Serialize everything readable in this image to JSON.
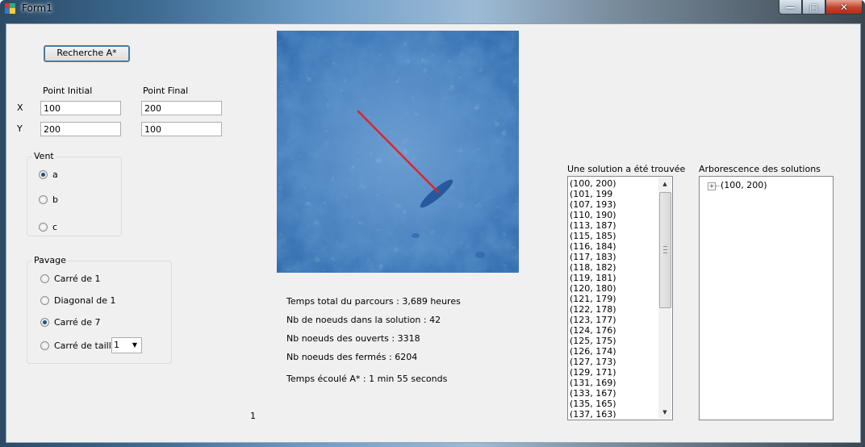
{
  "window": {
    "title": "Form1"
  },
  "title_buttons": {
    "minimize": "—",
    "maximize": "▢",
    "close": "✕"
  },
  "search_button": "Recherche A*",
  "coords": {
    "initial_label": "Point Initial",
    "final_label": "Point Final",
    "x_label": "X",
    "y_label": "Y",
    "initial_x": "100",
    "initial_y": "200",
    "final_x": "200",
    "final_y": "100"
  },
  "vent": {
    "title": "Vent",
    "options": [
      "a",
      "b",
      "c"
    ],
    "selected": "a"
  },
  "pavage": {
    "title": "Pavage",
    "options": [
      "Carré de 1",
      "Diagonal de 1",
      "Carré de 7",
      "Carré de taille"
    ],
    "selected": "Carré de 7",
    "taille_value": "1"
  },
  "stats": {
    "temps_total": "Temps total du parcours : 3,689 heures",
    "nb_noeuds_solution": "Nb de noeuds dans la solution : 42",
    "nb_noeuds_ouverts": "Nb noeuds des ouverts : 3318",
    "nb_noeuds_fermes": "Nb noeuds des fermés : 6204",
    "temps_ecoule": "Temps écoulé A* : 1 min 55 seconds"
  },
  "counter_label": "1",
  "solution_list": {
    "title": "Une solution a été trouvée",
    "items": [
      "(100, 200)",
      "(101, 199",
      "(107, 193)",
      "(110, 190)",
      "(113, 187)",
      "(115, 185)",
      "(116, 184)",
      "(117, 183)",
      "(118, 182)",
      "(119, 181)",
      "(120, 180)",
      "(121, 179)",
      "(122, 178)",
      "(123, 177)",
      "(124, 176)",
      "(125, 175)",
      "(126, 174)",
      "(127, 173)",
      "(129, 171)",
      "(131, 169)",
      "(133, 167)",
      "(135, 165)",
      "(137, 163)"
    ]
  },
  "tree": {
    "title": "Arborescence des solutions",
    "root": "(100, 200)"
  },
  "colors": {
    "path": "#e3202a",
    "accent": "#3c7fb1"
  }
}
